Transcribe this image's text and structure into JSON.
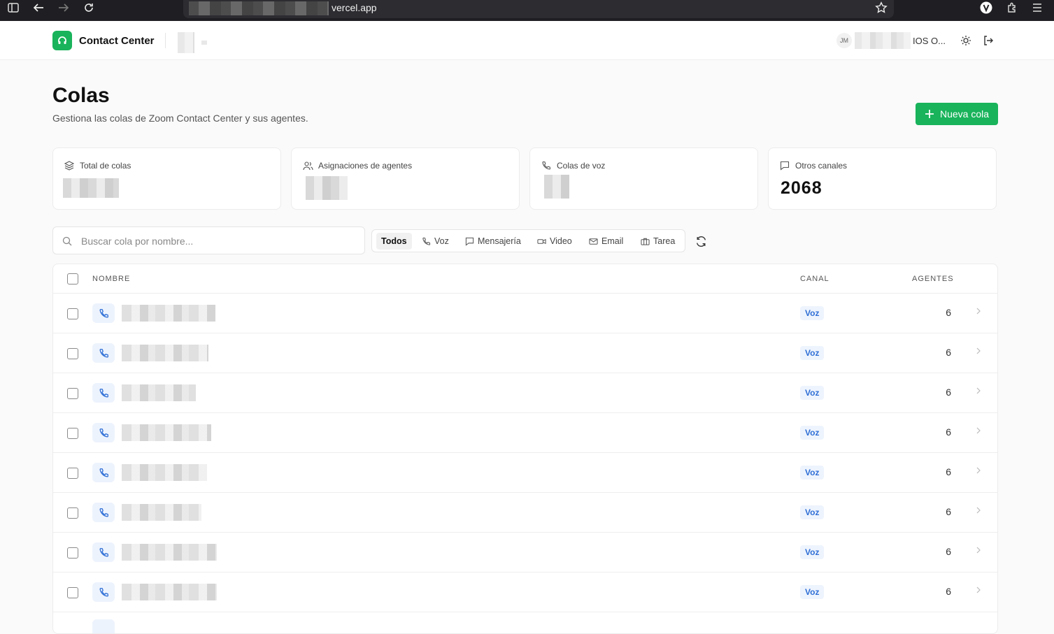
{
  "browser": {
    "url": "vercel.app"
  },
  "header": {
    "app_name": "Contact Center",
    "user_initials": "JM",
    "user_name": "IOS O..."
  },
  "page": {
    "title": "Colas",
    "subtitle": "Gestiona las colas de Zoom Contact Center y sus agentes.",
    "new_button": "Nueva cola"
  },
  "stats": [
    {
      "label": "Total de colas",
      "icon": "layers-icon",
      "value": ""
    },
    {
      "label": "Asignaciones de agentes",
      "icon": "users-icon",
      "value": ""
    },
    {
      "label": "Colas de voz",
      "icon": "phone-icon",
      "value": ""
    },
    {
      "label": "Otros canales",
      "icon": "message-icon",
      "value": "2068"
    }
  ],
  "search": {
    "placeholder": "Buscar cola por nombre..."
  },
  "filters": [
    {
      "label": "Todos",
      "active": true
    },
    {
      "label": "Voz",
      "icon": "phone-icon"
    },
    {
      "label": "Mensajería",
      "icon": "message-icon"
    },
    {
      "label": "Video",
      "icon": "video-icon"
    },
    {
      "label": "Email",
      "icon": "mail-icon"
    },
    {
      "label": "Tarea",
      "icon": "briefcase-icon"
    }
  ],
  "table": {
    "columns": {
      "name": "NOMBRE",
      "channel": "CANAL",
      "agents": "AGENTES"
    },
    "rows": [
      {
        "channel": "Voz",
        "agents": "6"
      },
      {
        "channel": "Voz",
        "agents": "6"
      },
      {
        "channel": "Voz",
        "agents": "6"
      },
      {
        "channel": "Voz",
        "agents": "6"
      },
      {
        "channel": "Voz",
        "agents": "6"
      },
      {
        "channel": "Voz",
        "agents": "6"
      },
      {
        "channel": "Voz",
        "agents": "6"
      },
      {
        "channel": "Voz",
        "agents": "6"
      }
    ]
  },
  "colors": {
    "accent": "#19b35b",
    "voice_badge": "#2f6fd6"
  }
}
